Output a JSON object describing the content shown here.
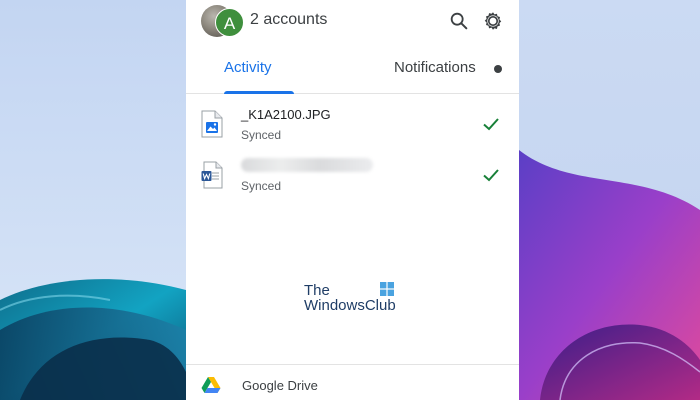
{
  "header": {
    "avatar_letter": "A",
    "accounts_label": "2 accounts",
    "search_icon": "search-icon",
    "settings_icon": "gear-icon"
  },
  "tabs": [
    {
      "label": "Activity",
      "selected": true
    },
    {
      "label": "Notifications",
      "selected": false,
      "has_unread_dot": true
    }
  ],
  "files": [
    {
      "name": "_K1A2100.JPG",
      "status": "Synced",
      "icon": "image-file-icon",
      "synced": true
    },
    {
      "name": "",
      "name_blurred": true,
      "status": "Synced",
      "icon": "word-file-icon",
      "synced": true
    }
  ],
  "watermark": {
    "line1": "The",
    "line2": "WindowsClub"
  },
  "footer": {
    "label": "Google Drive",
    "icon": "google-drive-icon"
  },
  "colors": {
    "accent": "#1a73e8",
    "check_green": "#188038",
    "avatar_green": "#3f8f3d",
    "panel_bg": "#ffffff"
  }
}
